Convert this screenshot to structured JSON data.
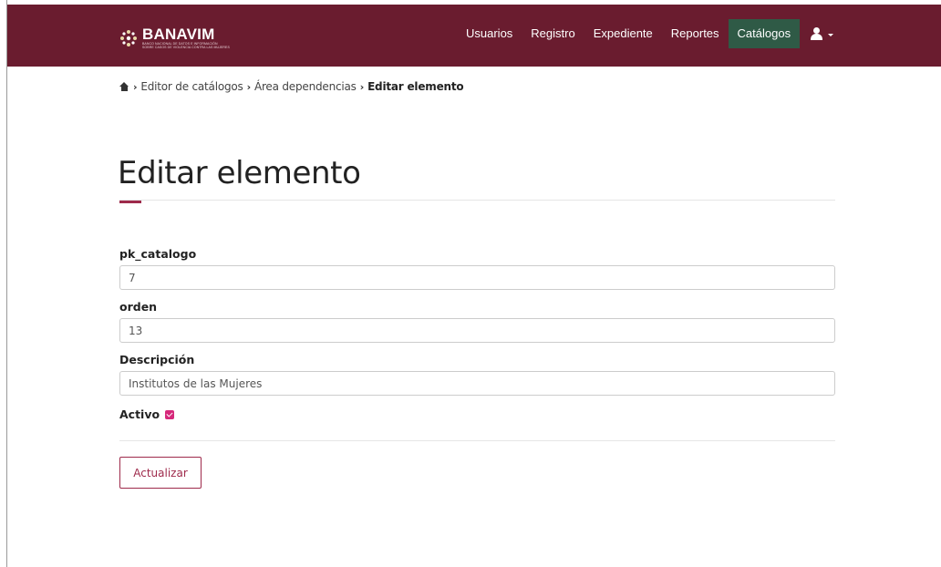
{
  "brand": {
    "title": "BANAVIM",
    "subtitle_line1": "BANCO NACIONAL DE DATOS E INFORMACIÓN",
    "subtitle_line2": "SOBRE CASOS DE VIOLENCIA CONTRA LAS MUJERES",
    "colors": {
      "navbar": "#6a1c2f",
      "active_tab": "#2f5a46",
      "accent": "#9e2a4b",
      "checkbox": "#d6287b"
    }
  },
  "nav": {
    "items": [
      {
        "label": "Usuarios"
      },
      {
        "label": "Registro"
      },
      {
        "label": "Expediente"
      },
      {
        "label": "Reportes"
      },
      {
        "label": "Catálogos",
        "active": true
      }
    ],
    "user_icon": "user-icon"
  },
  "breadcrumb": {
    "home_icon": "home-icon",
    "items": [
      "Editor de catálogos",
      "Área dependencias"
    ],
    "current": "Editar elemento"
  },
  "page": {
    "title": "Editar elemento"
  },
  "form": {
    "pk_catalogo": {
      "label": "pk_catalogo",
      "value": "7"
    },
    "orden": {
      "label": "orden",
      "value": "13"
    },
    "descripcion": {
      "label": "Descripción",
      "value": "Institutos de las Mujeres"
    },
    "activo": {
      "label": "Activo",
      "checked": true
    },
    "submit_label": "Actualizar"
  }
}
